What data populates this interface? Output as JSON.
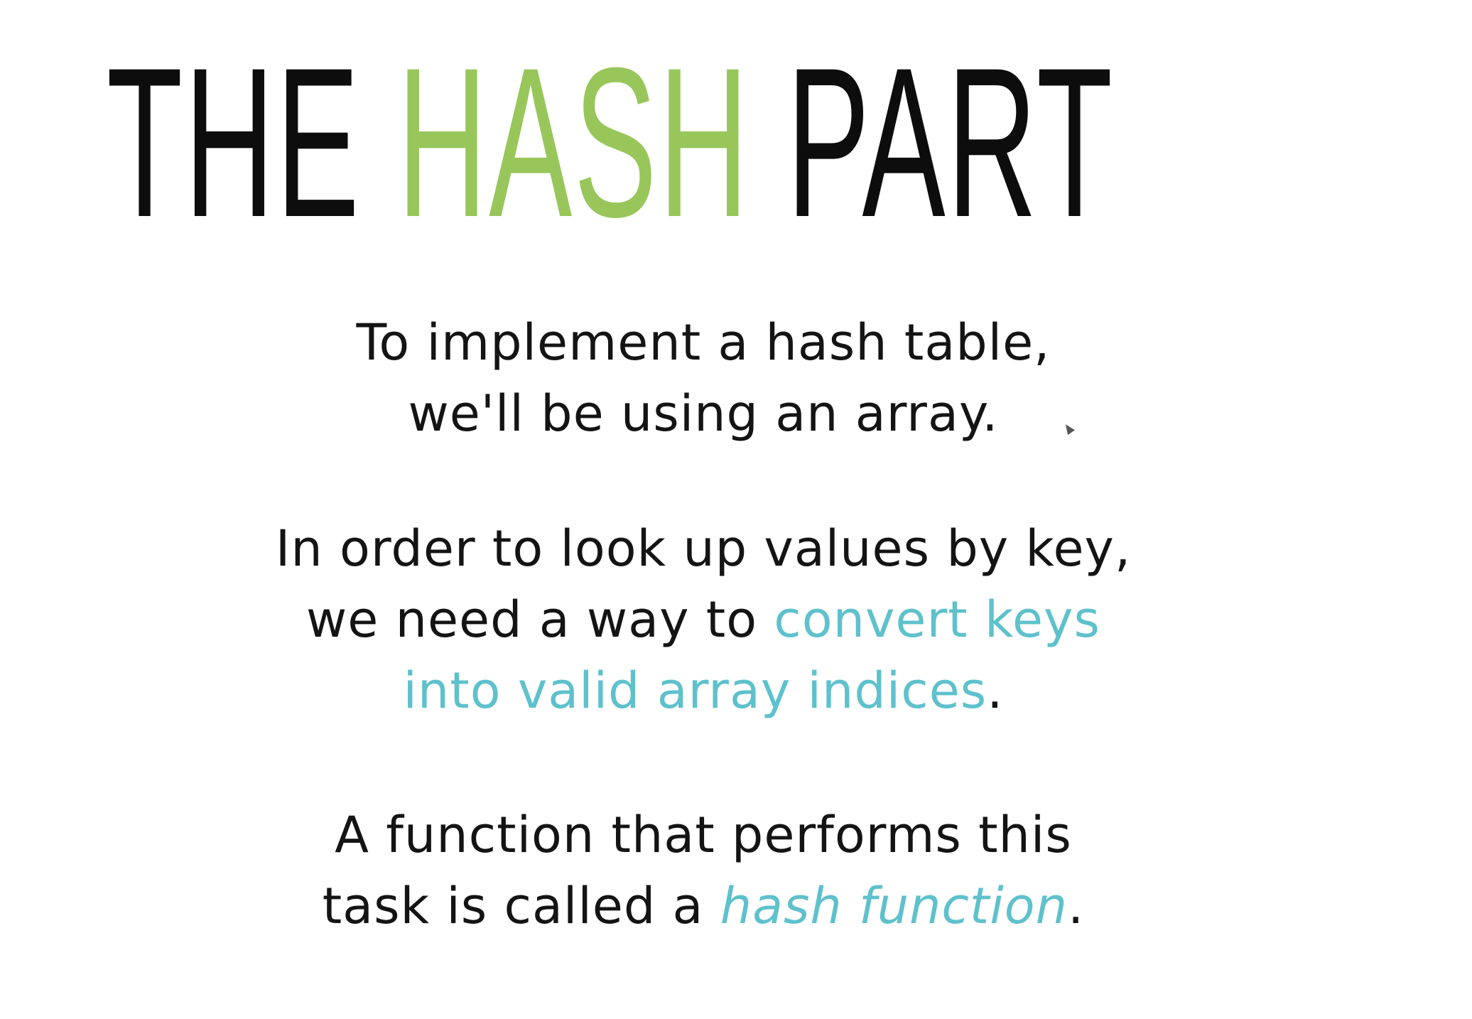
{
  "slide": {
    "title": {
      "part1": "THE",
      "part2": "HASH",
      "part3": "PART",
      "accent_color": "#98c65b"
    },
    "paragraphs": {
      "p1": {
        "line1": "To implement a hash table,",
        "line2": "we'll be using an array."
      },
      "p2": {
        "line1": "In order to look up values by key,",
        "line2_plain": "we need a way to",
        "line2_accent": "convert keys",
        "line3_accent": "into valid array indices",
        "line3_end": "."
      },
      "p3": {
        "line1": "A function that performs this",
        "line2_plain": "task is called a",
        "line2_accent": "hash function",
        "line2_end": "."
      }
    },
    "accent_text_color": "#5ec1cc",
    "cursor_icon": "mouse-pointer-icon"
  }
}
